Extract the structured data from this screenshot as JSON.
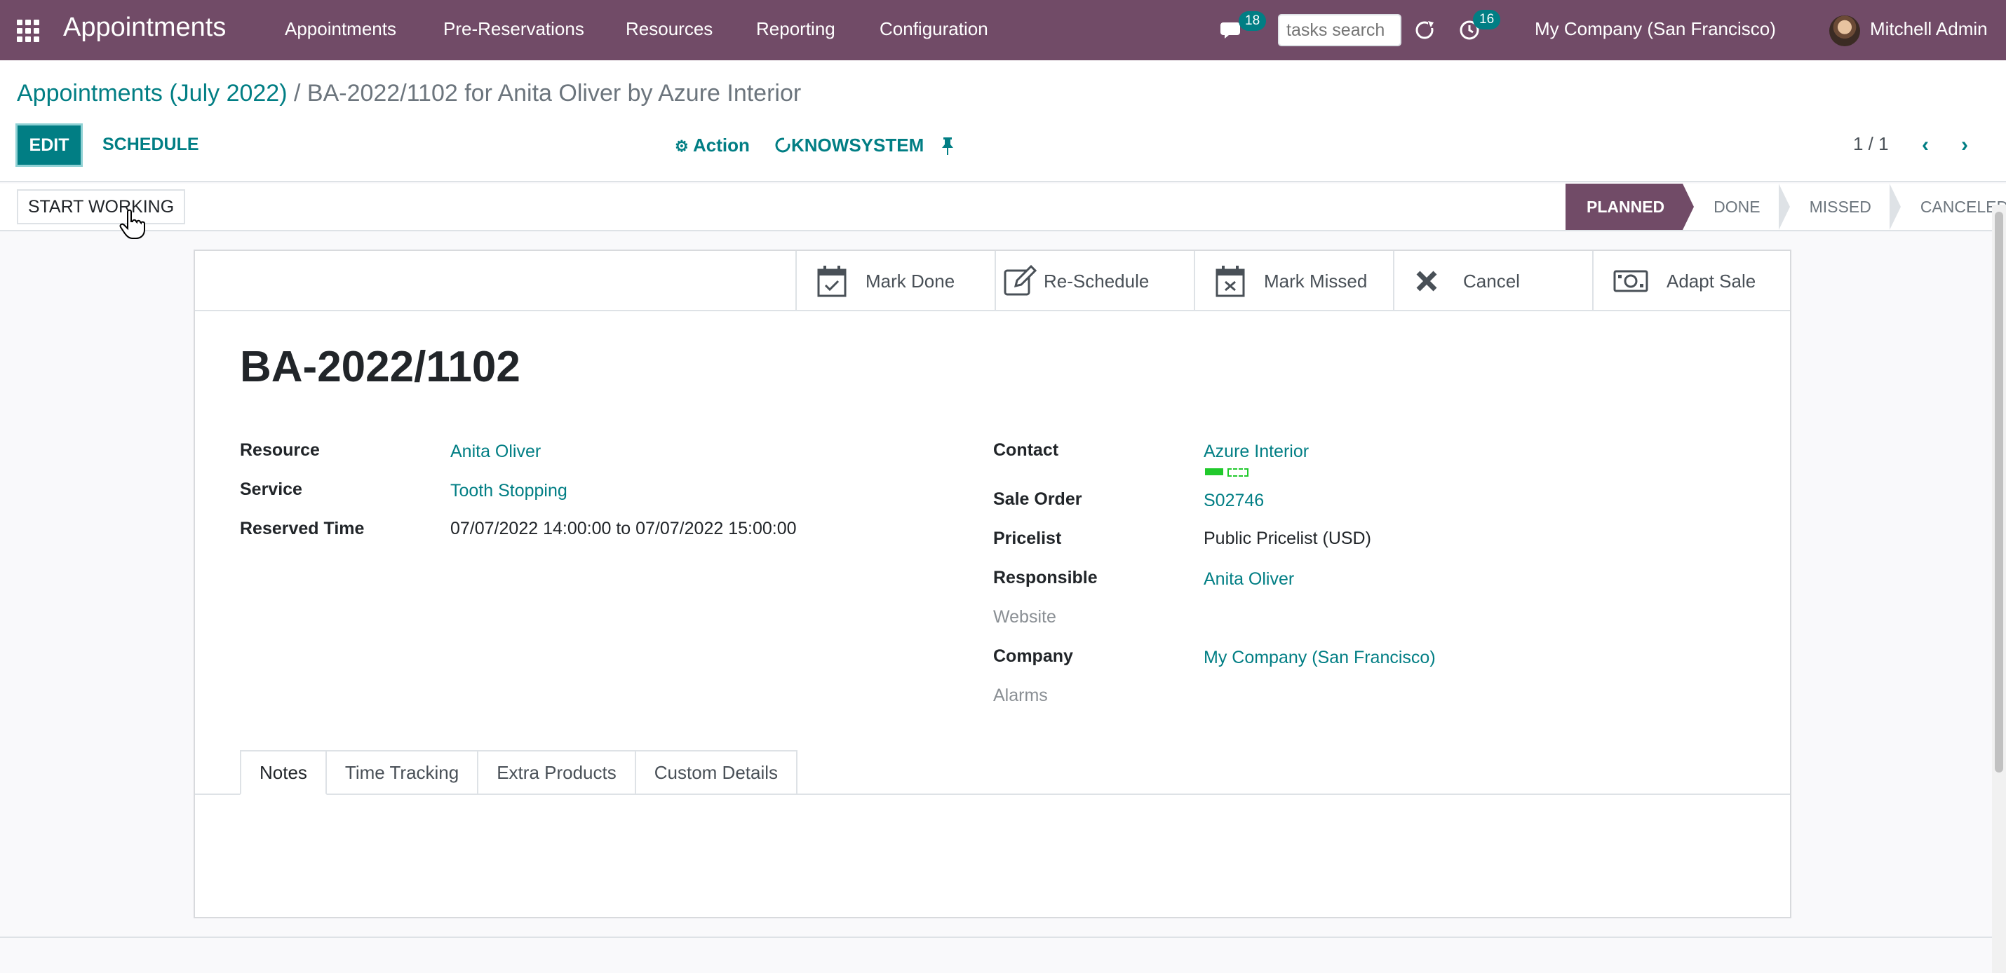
{
  "navbar": {
    "brand": "Appointments",
    "menu": [
      "Appointments",
      "Pre-Reservations",
      "Resources",
      "Reporting",
      "Configuration"
    ],
    "chat_count": "18",
    "search_placeholder": "tasks search",
    "activity_count": "16",
    "company": "My Company (San Francisco)",
    "user": "Mitchell Admin"
  },
  "breadcrumb": {
    "parent": "Appointments (July 2022)",
    "separator": " / ",
    "current": "BA-2022/1102 for Anita Oliver by Azure Interior"
  },
  "control": {
    "edit": "EDIT",
    "schedule": "SCHEDULE",
    "action": "Action",
    "knowsystem": "KNOWSYSTEM",
    "pager": "1 / 1"
  },
  "statusbar": {
    "start_working": "START WORKING",
    "stages": [
      "PLANNED",
      "DONE",
      "MISSED",
      "CANCELED"
    ],
    "active_stage": "PLANNED"
  },
  "smart_buttons": [
    "Mark Done",
    "Re-Schedule",
    "Mark Missed",
    "Cancel",
    "Adapt Sale"
  ],
  "record": {
    "title": "BA-2022/1102",
    "left_fields": [
      {
        "label": "Resource",
        "value": "Anita Oliver"
      },
      {
        "label": "Service",
        "value": "Tooth Stopping"
      },
      {
        "label": "Reserved Time",
        "value": "07/07/2022 14:00:00 to 07/07/2022 15:00:00"
      }
    ],
    "right_fields": [
      {
        "label": "Contact",
        "value": "Azure Interior"
      },
      {
        "label": "Sale Order",
        "value": "S02746"
      },
      {
        "label": "Pricelist",
        "value": "Public Pricelist (USD)"
      },
      {
        "label": "Responsible",
        "value": "Anita Oliver"
      },
      {
        "label": "Website",
        "value": ""
      },
      {
        "label": "Company",
        "value": "My Company (San Francisco)"
      },
      {
        "label": "Alarms",
        "value": ""
      }
    ]
  },
  "tabs": [
    "Notes",
    "Time Tracking",
    "Extra Products",
    "Custom Details"
  ],
  "colors": {
    "brand": "#714b67",
    "accent": "#017e84",
    "tag": "#21c92c"
  }
}
